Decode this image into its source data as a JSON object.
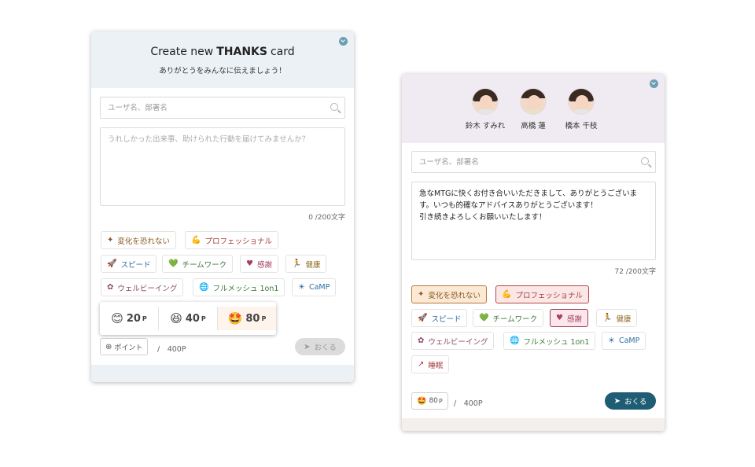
{
  "card1": {
    "title_pre": "Create new",
    "title_bold": "THANKS",
    "title_post": "card",
    "subtitle": "ありがとうをみんなに伝えましょう！",
    "search_placeholder": "ユーザ名、部署名",
    "message_placeholder": "うれしかった出来事、助けられた行動を届けてみませんか？",
    "message_value": "",
    "counter": "0 /200文字",
    "chips": [
      {
        "label": "変化を恐れない",
        "icon": "sparkles-icon"
      },
      {
        "label": "プロフェッショナル",
        "icon": "flexed-arm-icon"
      },
      {
        "label": "スピード",
        "icon": "rocket-icon"
      },
      {
        "label": "チームワーク",
        "icon": "heart-handshake-icon"
      },
      {
        "label": "感謝",
        "icon": "heart-icon"
      },
      {
        "label": "健康",
        "icon": "runner-icon"
      },
      {
        "label": "ウェルビーイング",
        "icon": "brain-icon"
      },
      {
        "label": "フルメッシュ 1on1",
        "icon": "globe-icon"
      },
      {
        "label": "CaMP",
        "icon": "sun-icon"
      }
    ],
    "points": [
      {
        "value": "20",
        "unit": "P",
        "icon": "smiling-face-icon"
      },
      {
        "value": "40",
        "unit": "P",
        "icon": "grinning-face-icon"
      },
      {
        "value": "80",
        "unit": "P",
        "icon": "star-eyes-face-icon"
      }
    ],
    "point_button": "ポイント",
    "total": "/　400P",
    "send": "おくる"
  },
  "card2": {
    "recipients": [
      {
        "name": "鈴木 すみれ"
      },
      {
        "name": "高橋 蓮"
      },
      {
        "name": "橋本 千枝"
      }
    ],
    "search_placeholder": "ユーザ名、部署名",
    "message_value": "急なMTGに快くお付き合いいただきまして、ありがとうございます。いつも的確なアドバイスありがとうございます！\n引き続きよろしくお願いいたします！",
    "counter": "72 /200文字",
    "chips": [
      {
        "label": "変化を恐れない",
        "icon": "sparkles-icon"
      },
      {
        "label": "プロフェッショナル",
        "icon": "flexed-arm-icon"
      },
      {
        "label": "スピード",
        "icon": "rocket-icon"
      },
      {
        "label": "チームワーク",
        "icon": "heart-handshake-icon"
      },
      {
        "label": "感謝",
        "icon": "heart-icon"
      },
      {
        "label": "健康",
        "icon": "runner-icon"
      },
      {
        "label": "ウェルビーイング",
        "icon": "brain-icon"
      },
      {
        "label": "フルメッシュ 1on1",
        "icon": "globe-icon"
      },
      {
        "label": "CaMP",
        "icon": "sun-icon"
      },
      {
        "label": "睡眠",
        "icon": "trend-icon"
      }
    ],
    "point_value": "80",
    "point_unit": "P",
    "total": "/　400P",
    "send": "おくる"
  }
}
